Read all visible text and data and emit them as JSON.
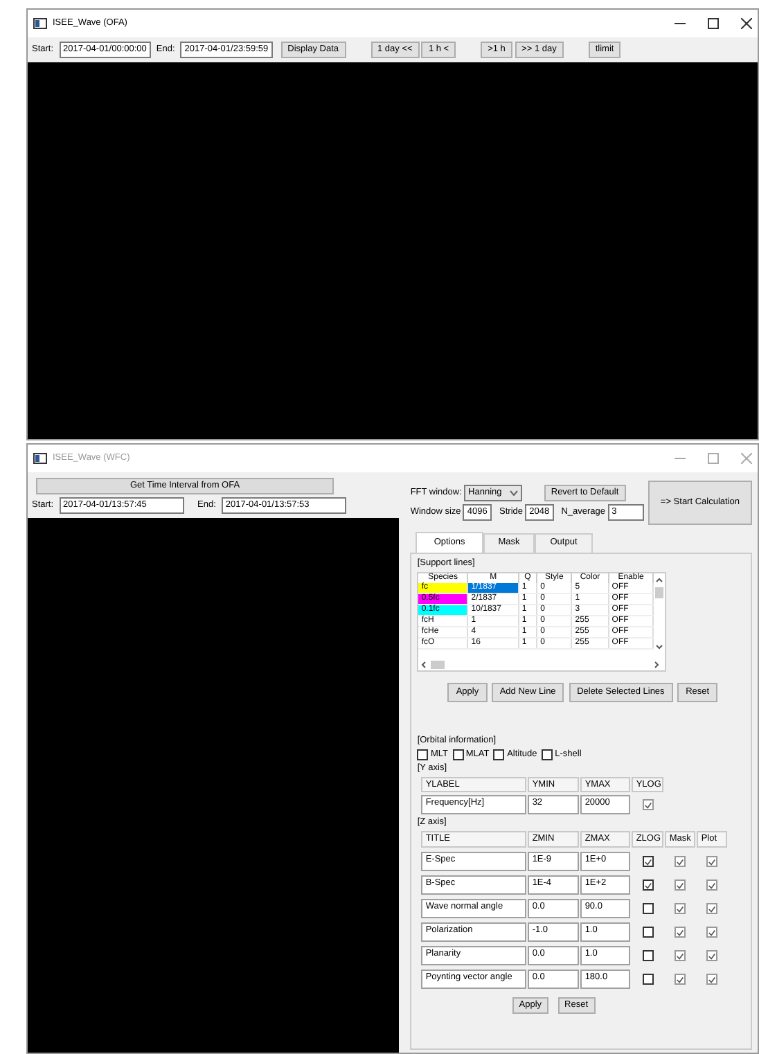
{
  "ofa_window": {
    "title": "ISEE_Wave (OFA)",
    "active": true,
    "start_label": "Start:",
    "start_value": "2017-04-01/00:00:00",
    "end_label": "End:",
    "end_value": "2017-04-01/23:59:59",
    "button_groups": [
      [
        "Display Data"
      ],
      [
        "1 day <<",
        "1 h <"
      ],
      [
        ">1 h",
        ">> 1 day"
      ],
      [
        "tlimit"
      ]
    ]
  },
  "wfc_window": {
    "title": "ISEE_Wave (WFC)",
    "active": false,
    "get_button": "Get Time Interval from OFA",
    "start_label": "Start:",
    "start_value": "2017-04-01/13:57:45",
    "end_label": "End:",
    "end_value": "2017-04-01/13:57:53",
    "fft_label": "FFT window:",
    "fft_value": "Hanning",
    "revert_button": "Revert to Default",
    "start_calc_button": "=> Start Calculation",
    "params": [
      {
        "label": "Window size",
        "value": "4096"
      },
      {
        "label": "Stride",
        "value": "2048"
      },
      {
        "label": "N_average",
        "value": "3"
      }
    ],
    "tabs": [
      {
        "label": "Options",
        "selected": true
      },
      {
        "label": "Mask",
        "selected": false
      },
      {
        "label": "Output",
        "selected": false
      }
    ],
    "support_lines": {
      "heading": "[Support lines]",
      "columns": [
        "Species",
        "M",
        "Q",
        "Style",
        "Color",
        "Enable"
      ],
      "rows": [
        {
          "species": "fc",
          "color": "#ffff00",
          "m": "1/1837",
          "q": "1",
          "style": "0",
          "color_index": "5",
          "enable": "OFF",
          "selected": true
        },
        {
          "species": "0.5fc",
          "color": "#ff00ff",
          "m": "2/1837",
          "q": "1",
          "style": "0",
          "color_index": "1",
          "enable": "OFF",
          "selected": false
        },
        {
          "species": "0.1fc",
          "color": "#00ffff",
          "m": "10/1837",
          "q": "1",
          "style": "0",
          "color_index": "3",
          "enable": "OFF",
          "selected": false
        },
        {
          "species": "fcH",
          "m": "1",
          "q": "1",
          "style": "0",
          "color_index": "255",
          "enable": "OFF",
          "selected": false
        },
        {
          "species": "fcHe",
          "m": "4",
          "q": "1",
          "style": "0",
          "color_index": "255",
          "enable": "OFF",
          "selected": false
        },
        {
          "species": "fcO",
          "m": "16",
          "q": "1",
          "style": "0",
          "color_index": "255",
          "enable": "OFF",
          "selected": false
        }
      ]
    },
    "line_buttons": [
      "Apply",
      "Add New Line",
      "Delete Selected Lines",
      "Reset"
    ],
    "orbital": {
      "heading": "[Orbital information]",
      "checks": [
        {
          "label": "MLT",
          "checked": false
        },
        {
          "label": "MLAT",
          "checked": false
        },
        {
          "label": "Altitude",
          "checked": false
        },
        {
          "label": "L-shell",
          "checked": false
        }
      ]
    },
    "y_axis": {
      "heading": "[Y axis]",
      "columns": [
        "YLABEL",
        "YMIN",
        "YMAX",
        "YLOG"
      ],
      "row": {
        "label": "Frequency[Hz]",
        "min": "32",
        "max": "20000",
        "log": true
      }
    },
    "z_axis": {
      "heading": "[Z axis]",
      "columns": [
        "TITLE",
        "ZMIN",
        "ZMAX",
        "ZLOG",
        "Mask",
        "Plot"
      ],
      "rows": [
        {
          "title": "E-Spec",
          "min": "1E-9",
          "max": "1E+0",
          "log": true,
          "mask": true,
          "plot": true
        },
        {
          "title": "B-Spec",
          "min": "1E-4",
          "max": "1E+2",
          "log": true,
          "mask": true,
          "plot": true
        },
        {
          "title": "Wave normal angle",
          "min": "0.0",
          "max": "90.0",
          "log": false,
          "mask": true,
          "plot": true
        },
        {
          "title": "Polarization",
          "min": "-1.0",
          "max": "1.0",
          "log": false,
          "mask": true,
          "plot": true
        },
        {
          "title": "Planarity",
          "min": "0.0",
          "max": "1.0",
          "log": false,
          "mask": true,
          "plot": true
        },
        {
          "title": "Poynting vector angle",
          "min": "0.0",
          "max": "180.0",
          "log": false,
          "mask": true,
          "plot": true
        }
      ]
    },
    "z_buttons": [
      "Apply",
      "Reset"
    ]
  }
}
